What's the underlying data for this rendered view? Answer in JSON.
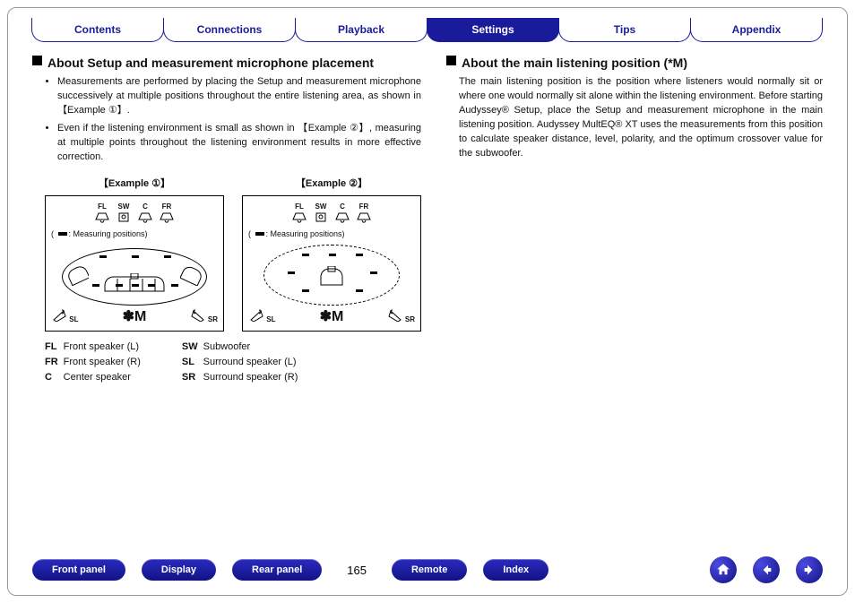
{
  "tabs": [
    {
      "label": "Contents",
      "active": false
    },
    {
      "label": "Connections",
      "active": false
    },
    {
      "label": "Playback",
      "active": false
    },
    {
      "label": "Settings",
      "active": true
    },
    {
      "label": "Tips",
      "active": false
    },
    {
      "label": "Appendix",
      "active": false
    }
  ],
  "left": {
    "heading": "About Setup and measurement microphone placement",
    "bullets": [
      "Measurements are performed by placing the Setup and measurement microphone successively at multiple positions throughout the entire listening area, as shown in 【Example ①】.",
      "Even if the listening environment is small as shown in 【Example ②】, measuring at multiple points throughout the listening environment results in more effective correction."
    ],
    "example1_label": "【Example ①】",
    "example2_label": "【Example ②】",
    "measuring_caption": ": Measuring positions)",
    "spk_labels": {
      "FL": "FL",
      "SW": "SW",
      "C": "C",
      "FR": "FR",
      "SL": "SL",
      "SR": "SR"
    },
    "m_mark": "M",
    "legend1": [
      {
        "abbr": "FL",
        "name": "Front speaker (L)"
      },
      {
        "abbr": "FR",
        "name": "Front speaker (R)"
      },
      {
        "abbr": "C",
        "name": "Center speaker"
      }
    ],
    "legend2": [
      {
        "abbr": "SW",
        "name": "Subwoofer"
      },
      {
        "abbr": "SL",
        "name": "Surround speaker (L)"
      },
      {
        "abbr": "SR",
        "name": "Surround speaker (R)"
      }
    ]
  },
  "right": {
    "heading": "About the main listening position (*M)",
    "body": "The main listening position is the position where listeners would normally sit or where one would normally sit alone within the listening environment. Before starting Audyssey® Setup, place the Setup and measurement microphone in the main listening position. Audyssey MultEQ® XT uses the measurements from this position to calculate speaker distance, level, polarity, and the optimum crossover value for the subwoofer."
  },
  "bottom": {
    "buttons": [
      "Front panel",
      "Display",
      "Rear panel"
    ],
    "page": "165",
    "buttons2": [
      "Remote",
      "Index"
    ],
    "nav": [
      "home",
      "back",
      "forward"
    ]
  }
}
